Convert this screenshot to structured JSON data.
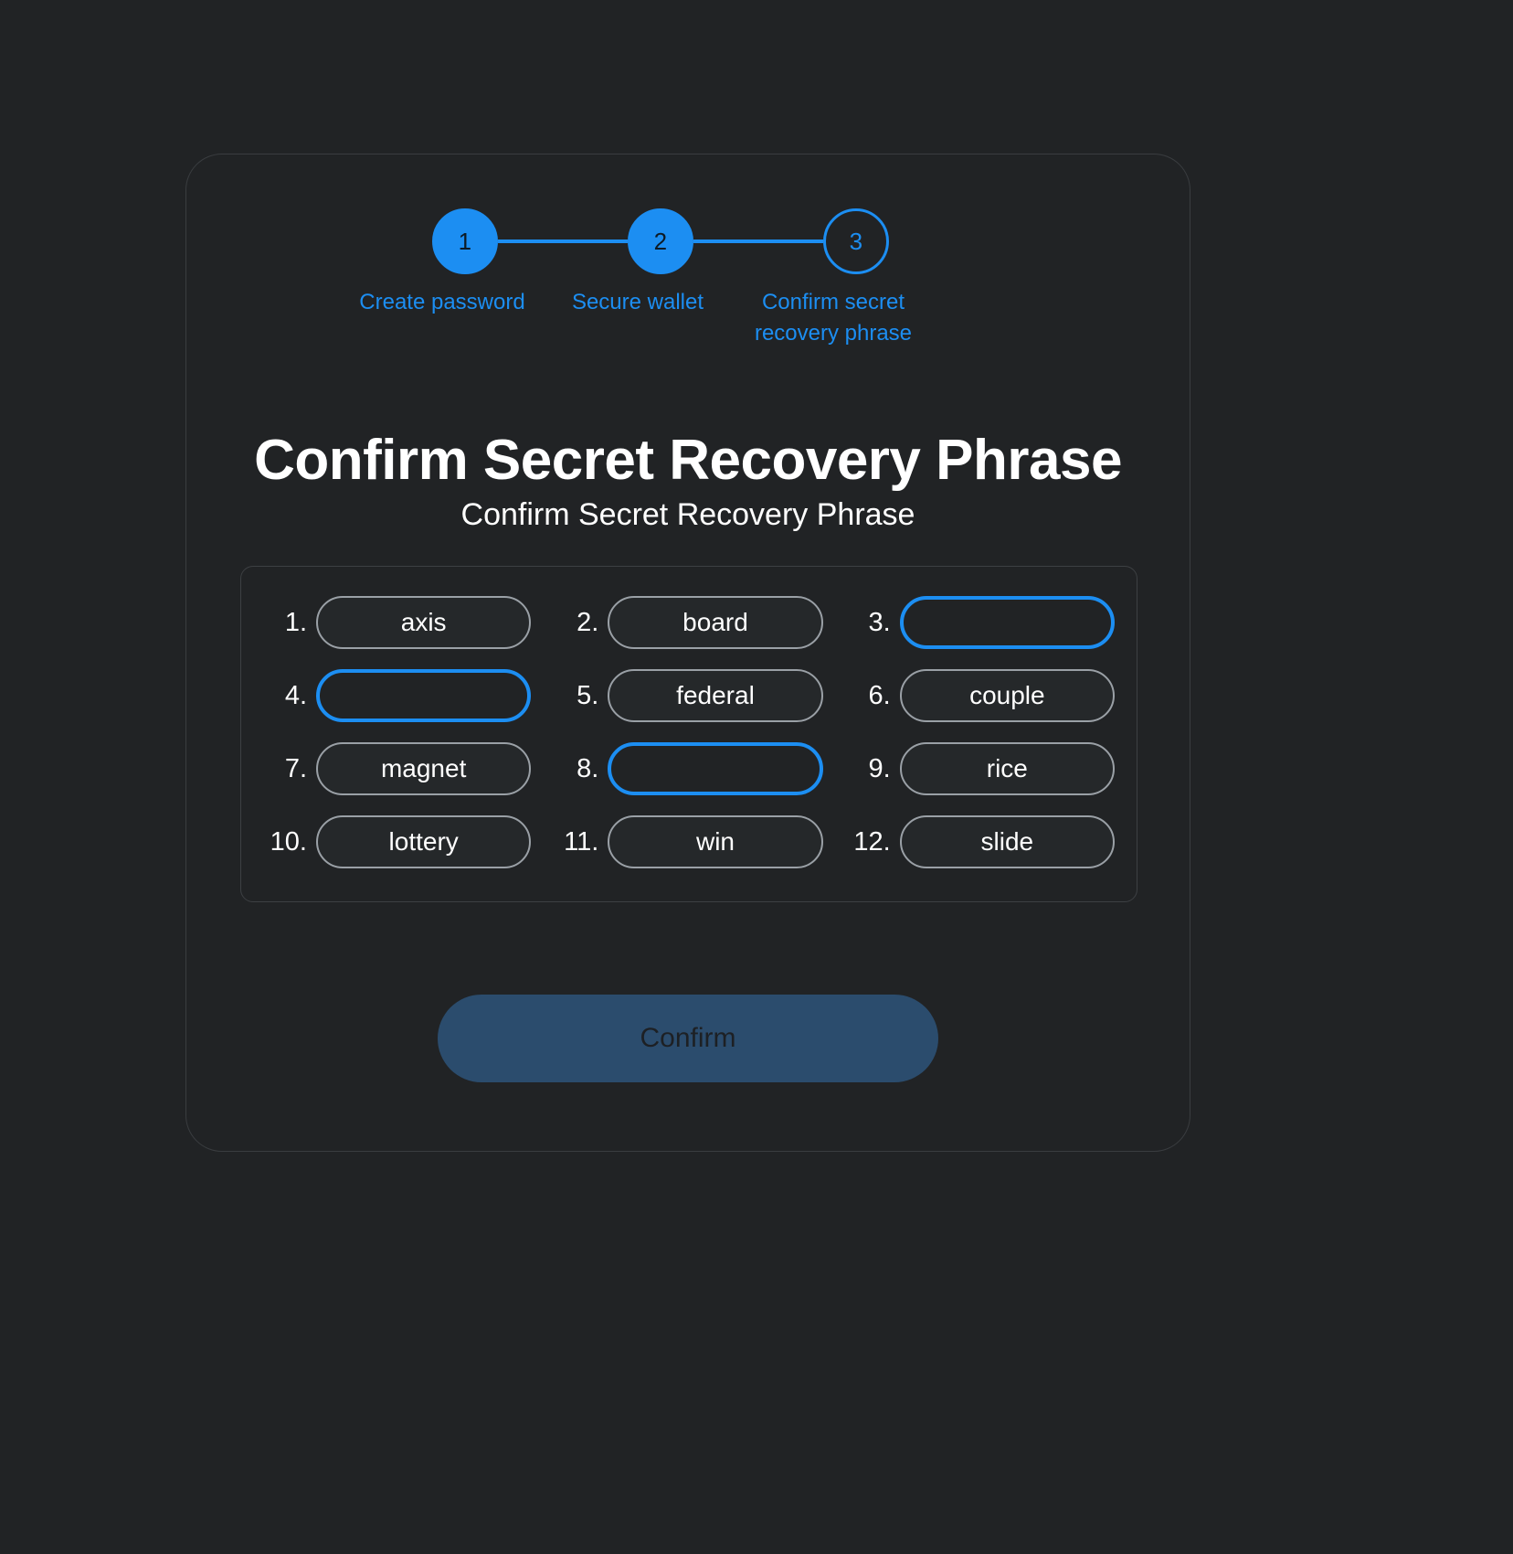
{
  "theme": {
    "background": "#212325",
    "accent": "#1c8ef2",
    "card_border": "#3a3d40",
    "grid_border": "#3d4043",
    "chip_border": "#9aa0a6",
    "text_primary": "#ffffff",
    "button_disabled_bg": "#2b4c6d",
    "button_disabled_text": "#1d2024"
  },
  "stepper": {
    "steps": [
      {
        "number": "1",
        "label": "Create password",
        "state": "done"
      },
      {
        "number": "2",
        "label": "Secure wallet",
        "state": "done"
      },
      {
        "number": "3",
        "label": "Confirm secret recovery phrase",
        "state": "current"
      }
    ]
  },
  "header": {
    "title": "Confirm Secret Recovery Phrase",
    "subtitle": "Confirm Secret Recovery Phrase"
  },
  "recovery_grid": {
    "words": [
      {
        "index": "1.",
        "value": "axis",
        "focused": false
      },
      {
        "index": "2.",
        "value": "board",
        "focused": false
      },
      {
        "index": "3.",
        "value": "",
        "focused": true
      },
      {
        "index": "4.",
        "value": "",
        "focused": true
      },
      {
        "index": "5.",
        "value": "federal",
        "focused": false
      },
      {
        "index": "6.",
        "value": "couple",
        "focused": false
      },
      {
        "index": "7.",
        "value": "magnet",
        "focused": false
      },
      {
        "index": "8.",
        "value": "",
        "focused": true
      },
      {
        "index": "9.",
        "value": "rice",
        "focused": false
      },
      {
        "index": "10.",
        "value": "lottery",
        "focused": false
      },
      {
        "index": "11.",
        "value": "win",
        "focused": false
      },
      {
        "index": "12.",
        "value": "slide",
        "focused": false
      }
    ]
  },
  "actions": {
    "confirm_label": "Confirm"
  }
}
